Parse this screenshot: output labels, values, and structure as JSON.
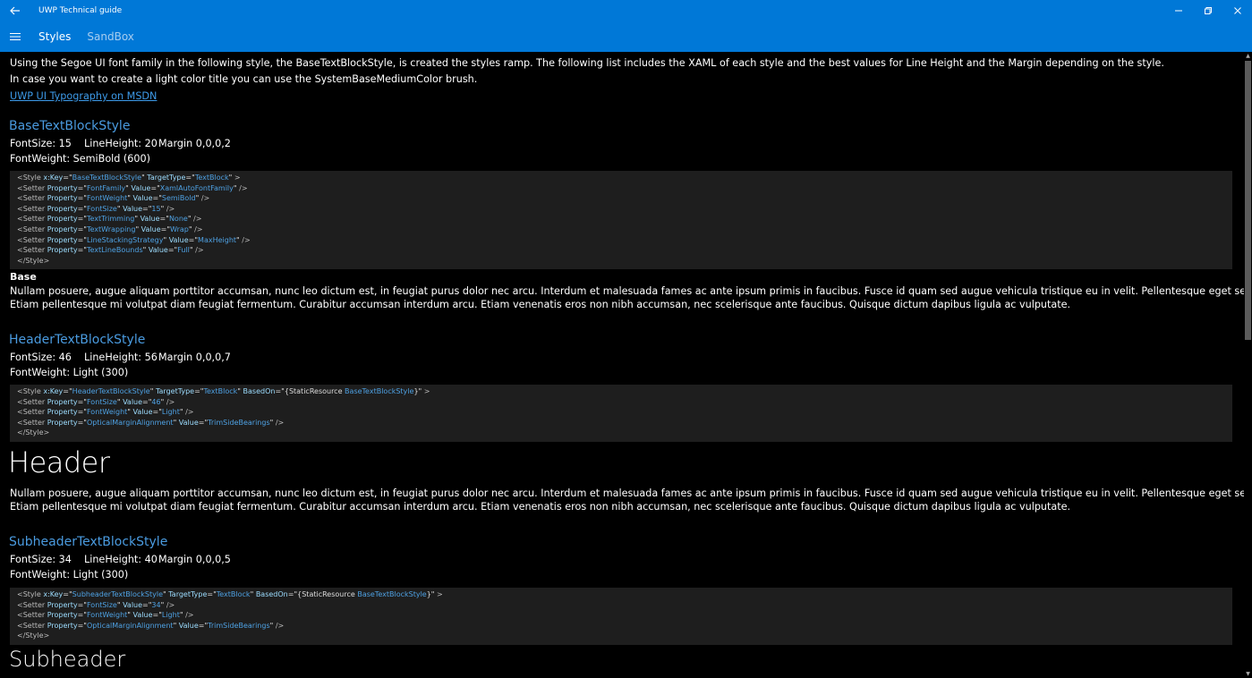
{
  "window": {
    "title": "UWP Technical guide",
    "back_icon": "arrow-left-icon",
    "minimize_glyph": "—",
    "restore_glyph": "❐",
    "close_glyph": "✕"
  },
  "nav": {
    "hamburger_glyph": "☰",
    "tabs": [
      {
        "label": "Styles",
        "active": true
      },
      {
        "label": "SandBox",
        "active": false
      }
    ],
    "accent_color": "#0078d7"
  },
  "intro": {
    "line1": "Using the Segoe UI font family in the following style, the BaseTextBlockStyle, is created the styles ramp. The following list includes the XAML of each style and the best values for Line Height and the Margin depending on the style.",
    "line2": "In case you want to create a light color title you can use the SystemBaseMediumColor brush.",
    "link": "UWP UI Typography on MSDN"
  },
  "styles": [
    {
      "title": "BaseTextBlockStyle",
      "fontsize": "FontSize: 15",
      "lineheight": "LineHeight: 20",
      "margin": "Margin 0,0,0,2",
      "fontweight": "FontWeight: SemiBold (600)",
      "sample": "Base",
      "paragraph1": "Nullam posuere, augue aliquam porttitor accumsan, nunc leo dictum est, in feugiat purus dolor nec arcu. Interdum et malesuada fames ac ante ipsum primis in faucibus. Fusce id quam sed augue vehicula tristique eu in velit. Pellentesque eget sem quis urna lobortis feugiat eu sit amet lec",
      "paragraph2": "Etiam pellentesque mi volutpat diam feugiat fermentum. Curabitur accumsan interdum arcu. Etiam venenatis eros non nibh accumsan, nec scelerisque ante faucibus. Quisque dictum dapibus ligula ac vulputate."
    },
    {
      "title": "HeaderTextBlockStyle",
      "fontsize": "FontSize: 46",
      "lineheight": "LineHeight: 56",
      "margin": "Margin 0,0,0,7",
      "fontweight": "FontWeight: Light (300)",
      "sample": "Header",
      "paragraph1": "Nullam posuere, augue aliquam porttitor accumsan, nunc leo dictum est, in feugiat purus dolor nec arcu. Interdum et malesuada fames ac ante ipsum primis in faucibus. Fusce id quam sed augue vehicula tristique eu in velit. Pellentesque eget sem quis urna lobortis feugiat eu sit amet lec",
      "paragraph2": "Etiam pellentesque mi volutpat diam feugiat fermentum. Curabitur accumsan interdum arcu. Etiam venenatis eros non nibh accumsan, nec scelerisque ante faucibus. Quisque dictum dapibus ligula ac vulputate."
    },
    {
      "title": "SubheaderTextBlockStyle",
      "fontsize": "FontSize: 34",
      "lineheight": "LineHeight: 40",
      "margin": "Margin 0,0,0,5",
      "fontweight": "FontWeight: Light (300)",
      "sample": "Subheader"
    }
  ],
  "code": {
    "base": [
      [
        [
          "tag",
          "<Style "
        ],
        [
          "attr",
          "x:Key"
        ],
        [
          "txt",
          "=\""
        ],
        [
          "val",
          "BaseTextBlockStyle"
        ],
        [
          "txt",
          "\" "
        ],
        [
          "attr",
          "TargetType"
        ],
        [
          "txt",
          "=\""
        ],
        [
          "val",
          "TextBlock"
        ],
        [
          "txt",
          "\" "
        ],
        [
          "tag",
          ">"
        ]
      ],
      [
        [
          "tag",
          "  <Setter "
        ],
        [
          "attr",
          "Property"
        ],
        [
          "txt",
          "=\""
        ],
        [
          "val",
          "FontFamily"
        ],
        [
          "txt",
          "\" "
        ],
        [
          "attr",
          "Value"
        ],
        [
          "txt",
          "=\""
        ],
        [
          "val",
          "XamlAutoFontFamily"
        ],
        [
          "txt",
          "\" "
        ],
        [
          "tag",
          "/>"
        ]
      ],
      [
        [
          "tag",
          "  <Setter "
        ],
        [
          "attr",
          "Property"
        ],
        [
          "txt",
          "=\""
        ],
        [
          "val",
          "FontWeight"
        ],
        [
          "txt",
          "\" "
        ],
        [
          "attr",
          "Value"
        ],
        [
          "txt",
          "=\""
        ],
        [
          "val",
          "SemiBold"
        ],
        [
          "txt",
          "\" "
        ],
        [
          "tag",
          "/>"
        ]
      ],
      [
        [
          "tag",
          "  <Setter "
        ],
        [
          "attr",
          "Property"
        ],
        [
          "txt",
          "=\""
        ],
        [
          "val",
          "FontSize"
        ],
        [
          "txt",
          "\" "
        ],
        [
          "attr",
          "Value"
        ],
        [
          "txt",
          "=\""
        ],
        [
          "val",
          "15"
        ],
        [
          "txt",
          "\" "
        ],
        [
          "tag",
          "/>"
        ]
      ],
      [
        [
          "tag",
          "  <Setter "
        ],
        [
          "attr",
          "Property"
        ],
        [
          "txt",
          "=\""
        ],
        [
          "val",
          "TextTrimming"
        ],
        [
          "txt",
          "\" "
        ],
        [
          "attr",
          "Value"
        ],
        [
          "txt",
          "=\""
        ],
        [
          "val",
          "None"
        ],
        [
          "txt",
          "\" "
        ],
        [
          "tag",
          "/>"
        ]
      ],
      [
        [
          "tag",
          "  <Setter "
        ],
        [
          "attr",
          "Property"
        ],
        [
          "txt",
          "=\""
        ],
        [
          "val",
          "TextWrapping"
        ],
        [
          "txt",
          "\" "
        ],
        [
          "attr",
          "Value"
        ],
        [
          "txt",
          "=\""
        ],
        [
          "val",
          "Wrap"
        ],
        [
          "txt",
          "\" "
        ],
        [
          "tag",
          "/>"
        ]
      ],
      [
        [
          "tag",
          "  <Setter "
        ],
        [
          "attr",
          "Property"
        ],
        [
          "txt",
          "=\""
        ],
        [
          "val",
          "LineStackingStrategy"
        ],
        [
          "txt",
          "\" "
        ],
        [
          "attr",
          "Value"
        ],
        [
          "txt",
          "=\""
        ],
        [
          "val",
          "MaxHeight"
        ],
        [
          "txt",
          "\" "
        ],
        [
          "tag",
          "/>"
        ]
      ],
      [
        [
          "tag",
          "  <Setter "
        ],
        [
          "attr",
          "Property"
        ],
        [
          "txt",
          "=\""
        ],
        [
          "val",
          "TextLineBounds"
        ],
        [
          "txt",
          "\" "
        ],
        [
          "attr",
          "Value"
        ],
        [
          "txt",
          "=\""
        ],
        [
          "val",
          "Full"
        ],
        [
          "txt",
          "\" "
        ],
        [
          "tag",
          "/>"
        ]
      ],
      [
        [
          "tag",
          "</Style>"
        ]
      ]
    ],
    "header": [
      [
        [
          "tag",
          "<Style "
        ],
        [
          "attr",
          "x:Key"
        ],
        [
          "txt",
          "=\""
        ],
        [
          "val",
          "HeaderTextBlockStyle"
        ],
        [
          "txt",
          "\" "
        ],
        [
          "attr",
          "TargetType"
        ],
        [
          "txt",
          "=\""
        ],
        [
          "val",
          "TextBlock"
        ],
        [
          "txt",
          "\" "
        ],
        [
          "attr",
          "BasedOn"
        ],
        [
          "txt",
          "=\"{StaticResource "
        ],
        [
          "val",
          "BaseTextBlockStyle"
        ],
        [
          "txt",
          "}\" "
        ],
        [
          "tag",
          ">"
        ]
      ],
      [
        [
          "tag",
          "  <Setter "
        ],
        [
          "attr",
          "Property"
        ],
        [
          "txt",
          "=\""
        ],
        [
          "val",
          "FontSize"
        ],
        [
          "txt",
          "\" "
        ],
        [
          "attr",
          "Value"
        ],
        [
          "txt",
          "=\""
        ],
        [
          "val",
          "46"
        ],
        [
          "txt",
          "\" "
        ],
        [
          "tag",
          "/>"
        ]
      ],
      [
        [
          "tag",
          "  <Setter "
        ],
        [
          "attr",
          "Property"
        ],
        [
          "txt",
          "=\""
        ],
        [
          "val",
          "FontWeight"
        ],
        [
          "txt",
          "\" "
        ],
        [
          "attr",
          "Value"
        ],
        [
          "txt",
          "=\""
        ],
        [
          "val",
          "Light"
        ],
        [
          "txt",
          "\" "
        ],
        [
          "tag",
          "/>"
        ]
      ],
      [
        [
          "tag",
          "  <Setter "
        ],
        [
          "attr",
          "Property"
        ],
        [
          "txt",
          "=\""
        ],
        [
          "val",
          "OpticalMarginAlignment"
        ],
        [
          "txt",
          "\" "
        ],
        [
          "attr",
          "Value"
        ],
        [
          "txt",
          "=\""
        ],
        [
          "val",
          "TrimSideBearings"
        ],
        [
          "txt",
          "\" "
        ],
        [
          "tag",
          "/>"
        ]
      ],
      [
        [
          "tag",
          "</Style>"
        ]
      ]
    ],
    "subheader": [
      [
        [
          "tag",
          "<Style "
        ],
        [
          "attr",
          "x:Key"
        ],
        [
          "txt",
          "=\""
        ],
        [
          "val",
          "SubheaderTextBlockStyle"
        ],
        [
          "txt",
          "\" "
        ],
        [
          "attr",
          "TargetType"
        ],
        [
          "txt",
          "=\""
        ],
        [
          "val",
          "TextBlock"
        ],
        [
          "txt",
          "\" "
        ],
        [
          "attr",
          "BasedOn"
        ],
        [
          "txt",
          "=\"{StaticResource "
        ],
        [
          "val",
          "BaseTextBlockStyle"
        ],
        [
          "txt",
          "}\" "
        ],
        [
          "tag",
          ">"
        ]
      ],
      [
        [
          "tag",
          "  <Setter "
        ],
        [
          "attr",
          "Property"
        ],
        [
          "txt",
          "=\""
        ],
        [
          "val",
          "FontSize"
        ],
        [
          "txt",
          "\" "
        ],
        [
          "attr",
          "Value"
        ],
        [
          "txt",
          "=\""
        ],
        [
          "val",
          "34"
        ],
        [
          "txt",
          "\" "
        ],
        [
          "tag",
          "/>"
        ]
      ],
      [
        [
          "tag",
          "  <Setter "
        ],
        [
          "attr",
          "Property"
        ],
        [
          "txt",
          "=\""
        ],
        [
          "val",
          "FontWeight"
        ],
        [
          "txt",
          "\" "
        ],
        [
          "attr",
          "Value"
        ],
        [
          "txt",
          "=\""
        ],
        [
          "val",
          "Light"
        ],
        [
          "txt",
          "\" "
        ],
        [
          "tag",
          "/>"
        ]
      ],
      [
        [
          "tag",
          "  <Setter "
        ],
        [
          "attr",
          "Property"
        ],
        [
          "txt",
          "=\""
        ],
        [
          "val",
          "OpticalMarginAlignment"
        ],
        [
          "txt",
          "\" "
        ],
        [
          "attr",
          "Value"
        ],
        [
          "txt",
          "=\""
        ],
        [
          "val",
          "TrimSideBearings"
        ],
        [
          "txt",
          "\" "
        ],
        [
          "tag",
          "/>"
        ]
      ],
      [
        [
          "tag",
          "</Style>"
        ]
      ]
    ]
  }
}
